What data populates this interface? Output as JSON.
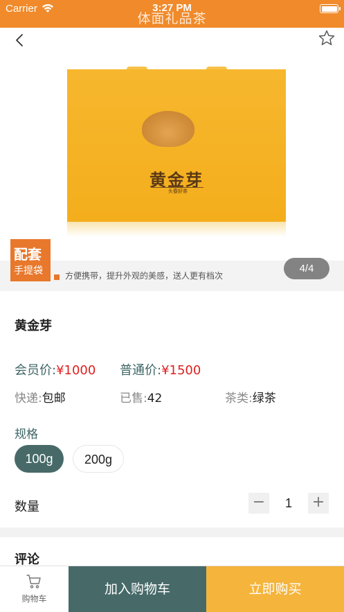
{
  "status_bar": {
    "carrier": "Carrier",
    "time": "3:27 PM"
  },
  "nav": {
    "title": "体面礼品茶"
  },
  "gallery": {
    "bag_brand": "黄金芽",
    "bag_subtitle": "头春好茶",
    "promo_line1": "配套",
    "promo_line2": "手提袋",
    "promo_text": "方便携带，提升外观的美感，送人更有档次",
    "page_indicator": "4/4"
  },
  "product": {
    "name": "黄金芽",
    "member_price_label": "会员价:",
    "member_price_value": "¥1000",
    "regular_price_label": "普通价:",
    "regular_price_value": "¥1500",
    "shipping_label": "快递:",
    "shipping_value": "包邮",
    "sold_label": "已售:",
    "sold_value": "42",
    "tea_type_label": "茶类:",
    "tea_type_value": "绿茶"
  },
  "spec": {
    "title": "规格",
    "options": [
      {
        "label": "100g",
        "selected": true
      },
      {
        "label": "200g",
        "selected": false
      }
    ]
  },
  "quantity": {
    "label": "数量",
    "minus": "−",
    "value": "1",
    "plus": "+"
  },
  "comments": {
    "title": "评论"
  },
  "bottom_bar": {
    "cart_label": "购物车",
    "add_to_cart": "加入购物车",
    "buy_now": "立即购买"
  },
  "colors": {
    "status_bar": "#f08a2a",
    "accent_teal": "#476a69",
    "price_red": "#e02020",
    "buy_orange": "#f5b43c"
  },
  "icons": [
    "wifi-icon",
    "battery-icon",
    "back-arrow-icon",
    "star-icon",
    "cart-icon"
  ]
}
